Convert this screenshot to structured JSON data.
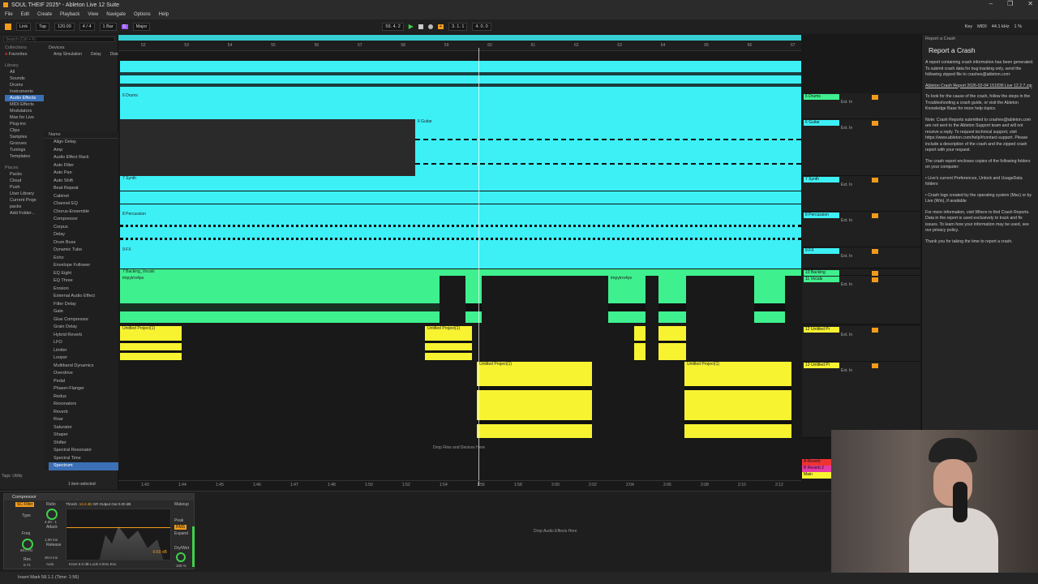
{
  "window": {
    "title": "SOUL THEIF 2025* - Ableton Live 12 Suite"
  },
  "menu": [
    "File",
    "Edit",
    "Create",
    "Playback",
    "View",
    "Navigate",
    "Options",
    "Help"
  ],
  "transport": {
    "link": "Link",
    "tap": "Tap",
    "tempo": "120.00",
    "sig": "4 / 4",
    "bar": "1 Bar",
    "key": "C",
    "scale": "Major",
    "pos1": "59.  4.  2",
    "pos2": "3.  1.  1",
    "pos3": "4.  0.  0",
    "key_label": "Key",
    "midi": "MIDI",
    "rate": "44.1 kHz",
    "cpu": "1 %"
  },
  "browser": {
    "search_placeholder": "Search (Ctrl + F)",
    "collections_label": "Collections",
    "favorites": "Favorites",
    "library_label": "Library",
    "library": [
      "All",
      "Sounds",
      "Drums",
      "Instruments",
      "Audio Effects",
      "MIDI Effects",
      "Modulators",
      "Max for Live",
      "Plug-ins",
      "Clips",
      "Samples",
      "Grooves",
      "Tunings",
      "Templates"
    ],
    "places_label": "Places",
    "places": [
      "Packs",
      "Cloud",
      "Push",
      "User Library",
      "Current Proje",
      "packs",
      "Add Folder..."
    ],
    "devices_label": "Devices",
    "categories": [
      "Amp Simulation",
      "Delay",
      "Distortion",
      "Dynamics",
      "EQ",
      "Filter",
      "Guitar",
      "Hardware Control",
      "Looping",
      "Mixing & Mastering",
      "Modulation",
      "Modulator",
      "Performance & DJ",
      "Pitch Correction",
      "Pitch Shift",
      "Racks",
      "Resonator",
      "Reverb",
      "Spatialization",
      "Utility",
      "Vintage Emulation",
      "Vocal"
    ],
    "name_header": "Name",
    "items": [
      "Align Delay",
      "Amp",
      "Audio Effect Rack",
      "Auto Filter",
      "Auto Pan",
      "Auto Shift",
      "Beat Repeat",
      "Cabinet",
      "Channel EQ",
      "Chorus-Ensemble",
      "Compressor",
      "Corpus",
      "Delay",
      "Drum Buss",
      "Dynamic Tube",
      "Echo",
      "Envelope Follower",
      "EQ Eight",
      "EQ Three",
      "Erosion",
      "External Audio Effect",
      "Filter Delay",
      "Gate",
      "Glue Compressor",
      "Grain Delay",
      "Hybrid Reverb",
      "LFO",
      "Limiter",
      "Looper",
      "Multiband Dynamics",
      "Overdrive",
      "Pedal",
      "Phaser-Flanger",
      "Redux",
      "Resonators",
      "Reverb",
      "Roar",
      "Saturator",
      "Shaper",
      "Shifter",
      "Spectral Resonator",
      "Spectral Time",
      "Spectrum"
    ],
    "tags": "Tags:",
    "tag_utility": "Utility",
    "selected_info": "1 item selected"
  },
  "ruler": [
    "52",
    "53",
    "54",
    "55",
    "56",
    "57",
    "58",
    "59",
    "60",
    "61",
    "62",
    "63",
    "64",
    "65",
    "66",
    "67"
  ],
  "timeline": [
    "1:43",
    "1:44",
    "1:45",
    "1:46",
    "1:47",
    "1:48",
    "1:50",
    "1:52",
    "1:54",
    "1:56",
    "1:58",
    "2:00",
    "2:02",
    "2:04",
    "2:06",
    "2:08",
    "2:10",
    "2:12"
  ],
  "tracks": [
    {
      "name": "5 Drums",
      "io": "Ext. In",
      "color": "#f29b1b"
    },
    {
      "name": "6 Guitar",
      "io": "Ext. In",
      "color": "#f29b1b"
    },
    {
      "name": "7 Synth",
      "io": "Ext. In",
      "color": "#f29b1b"
    },
    {
      "name": "8 Percussion",
      "io": "Ext. In",
      "color": "#f29b1b"
    },
    {
      "name": "9 FX",
      "io": "Ext. In",
      "color": "#f29b1b"
    },
    {
      "name": "10 Backing",
      "io": "Ext. In",
      "color": "#f29b1b"
    },
    {
      "name": "11 Vocals",
      "io": "Ext. In",
      "color": "#f29b1b"
    },
    {
      "name": "12 Untitled Pr",
      "io": "Ext. In",
      "color": "#f29b1b"
    },
    {
      "name": "13 Untitled Pr",
      "io": "Ext. In",
      "color": "#f29b1b"
    }
  ],
  "clips": {
    "drums": "6 Drums",
    "guitar": "6 Guitar",
    "synth": "7 Synth",
    "perc": "8 Percussion",
    "fx": "9 FX",
    "backing": "7 Backing_Vocals",
    "vocal": "tmpytrrs4ps",
    "untitled": "Untitled Project(1)"
  },
  "returns": [
    "A Reverb",
    "B Reverb 2",
    "Main"
  ],
  "drop_files": "Drop Files and Devices Here",
  "drop_effects": "Drop Audio Effects Here",
  "report": {
    "panel_title": "Report a Crash",
    "heading": "Report a Crash",
    "p1": "A report containing crash information has been generated. To submit crash data for bug tracking only, send the following zipped file to crashes@ableton.com:",
    "file": "Ableton Crash Report 2026-02-04 151836 Live 12.2.7.zip",
    "p2": "To look for the cause of the crash, follow the steps in the Troubleshooting a crash guide, or visit the Ableton Knowledge Base for more help topics.",
    "p3": "Note: Crash Reports submitted to crashes@ableton.com are not sent to the Ableton Support team and will not receive a reply. To request technical support, visit https://www.ableton.com/help/#contact-support. Please include a description of the crash and the zipped crash report with your request.",
    "p4": "The crash report encloses copies of the following folders on your computer:",
    "b1": "Live's current Preferences, Unlock and UsageData folders",
    "b2": "Crash logs created by the operating system (Mac) or by Live (Win), if available",
    "p5": "For more information, visit Where to find Crash Reports. Data in the report is used exclusively to track and fix issues. To learn how your information may be used, see our privacy policy.",
    "p6": "Thank you for taking the time to report a crash."
  },
  "device": {
    "name": "Compressor",
    "sc": "SC Filter",
    "type": "Type",
    "freq": "Freq",
    "freq_val": "80.0 Hz",
    "res": "Res",
    "res_val": "0.71",
    "ratio": "Ratio",
    "ratio_val": "4.00 : 1",
    "attack": "Attack",
    "attack_val": "1.00 ms",
    "release": "Release",
    "release_val": "30.0 ms",
    "auto": "Auto",
    "thresh": "Thresh",
    "thresh_val": "-16.6 dB",
    "gr": "GR",
    "output": "Output",
    "out": "Out",
    "out_val": "0.00 dB",
    "makeup": "Makeup",
    "peak": "Peak",
    "rms": "RMS",
    "expand": "Expand",
    "knee": "Knee",
    "knee_val": "6.0 dB",
    "look": "Look",
    "look_val": "0.0ms",
    "env": "Env",
    "drywet": "Dry/Wet",
    "drywet_val": "100 %",
    "gain": "-0.60 dB"
  },
  "status": "Insert Mark 58.1.1 (Time: 1:56)"
}
